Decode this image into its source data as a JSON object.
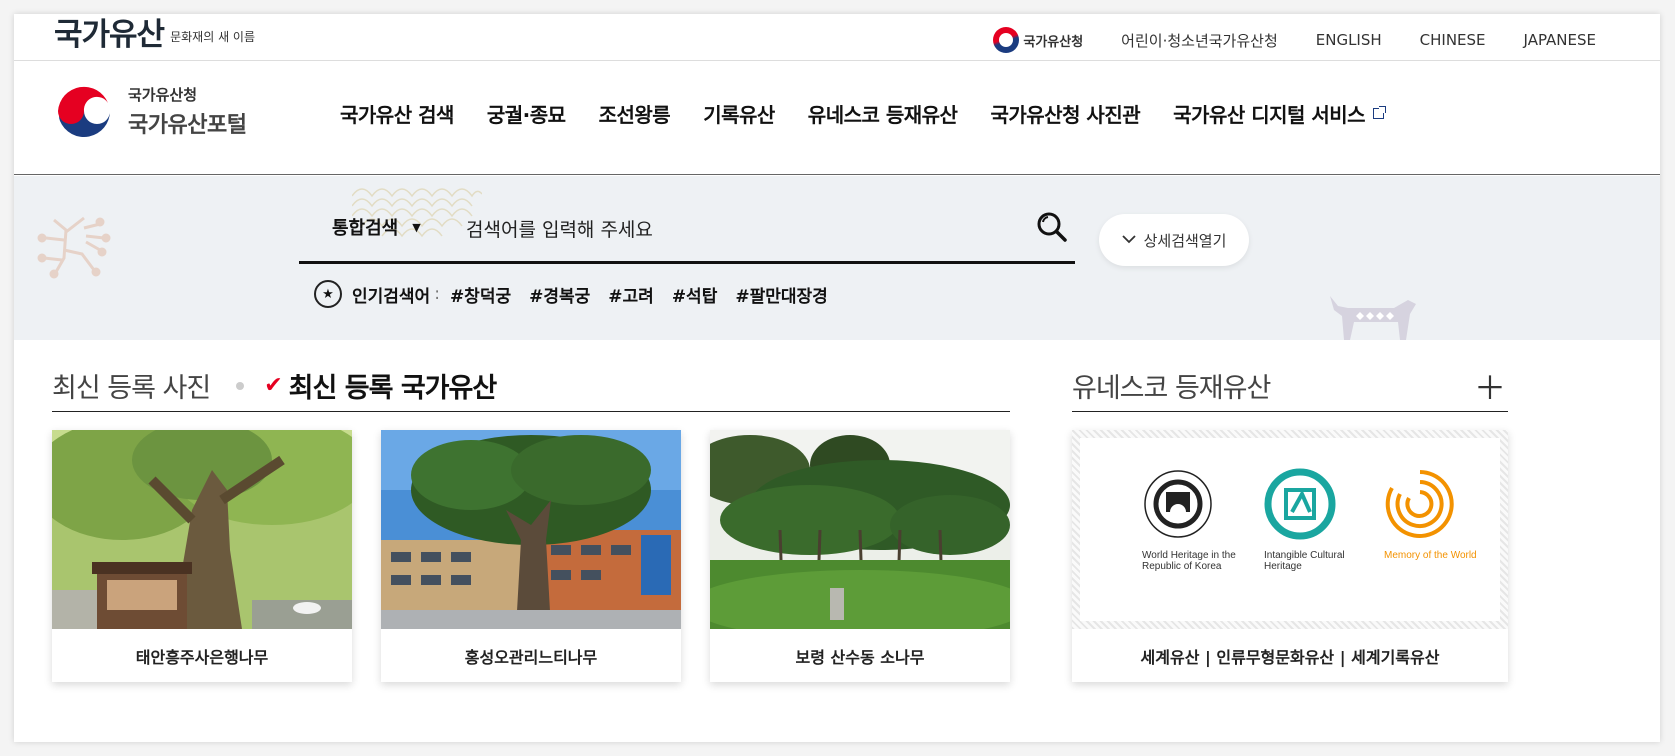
{
  "utility": {
    "brand_big": "국가유산",
    "brand_small": "문화재의 새 이름",
    "gov_label": "국가유산청",
    "links": [
      "어린이·청소년국가유산청",
      "ENGLISH",
      "CHINESE",
      "JAPANESE"
    ]
  },
  "header": {
    "logo_line1": "국가유산청",
    "logo_line2": "국가유산포털",
    "nav": [
      "국가유산 검색",
      "궁궐·종묘",
      "조선왕릉",
      "기록유산",
      "유네스코 등재유산",
      "국가유산청 사진관",
      "국가유산 디지털 서비스"
    ]
  },
  "search": {
    "scope_label": "통합검색",
    "placeholder": "검색어를 입력해 주세요",
    "detail_button": "상세검색열기",
    "popular_label": "인기검색어",
    "popular_tags": [
      "#창덕궁",
      "#경복궁",
      "#고려",
      "#석탑",
      "#팔만대장경"
    ]
  },
  "latest": {
    "tab_photos": "최신 등록 사진",
    "tab_heritage": "최신 등록 국가유산",
    "cards": [
      {
        "caption": "태안흥주사은행나무"
      },
      {
        "caption": "홍성오관리느티나무"
      },
      {
        "caption": "보령 산수동 소나무"
      }
    ]
  },
  "unesco": {
    "title": "유네스코 등재유산",
    "logos": [
      {
        "label": "World Heritage in the Republic of Korea",
        "color": "#222222"
      },
      {
        "label": "Intangible Cultural Heritage",
        "color": "#1aa6a0"
      },
      {
        "label": "Memory of the World",
        "color": "#f39200"
      }
    ],
    "caption": "세계유산 | 인류무형문화유산 | 세계기록유산"
  },
  "colors": {
    "accent_red": "#e50021",
    "accent_blue": "#1b3c80",
    "band_bg": "#eef1f4"
  }
}
